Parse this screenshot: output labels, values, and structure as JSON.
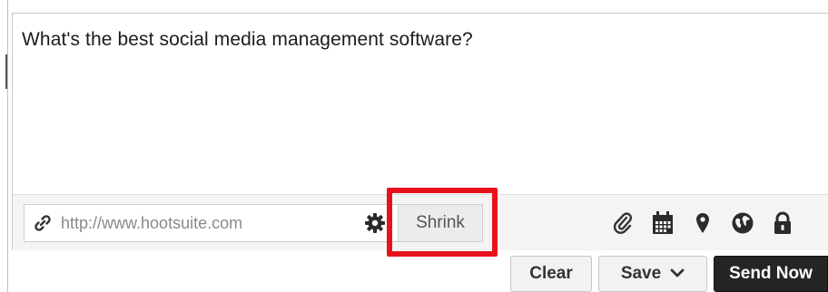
{
  "composer": {
    "message": "What's the best social media management software?"
  },
  "link_bar": {
    "url_placeholder": "http://www.hootsuite.com",
    "shrink_label": "Shrink",
    "icons": [
      "link-icon",
      "gear-icon",
      "paperclip-icon",
      "calendar-icon",
      "location-pin-icon",
      "globe-icon",
      "lock-icon"
    ]
  },
  "actions": {
    "clear_label": "Clear",
    "save_label": "Save",
    "send_label": "Send Now"
  },
  "colors": {
    "highlight": "#e8121c",
    "send_button": "#252525"
  }
}
